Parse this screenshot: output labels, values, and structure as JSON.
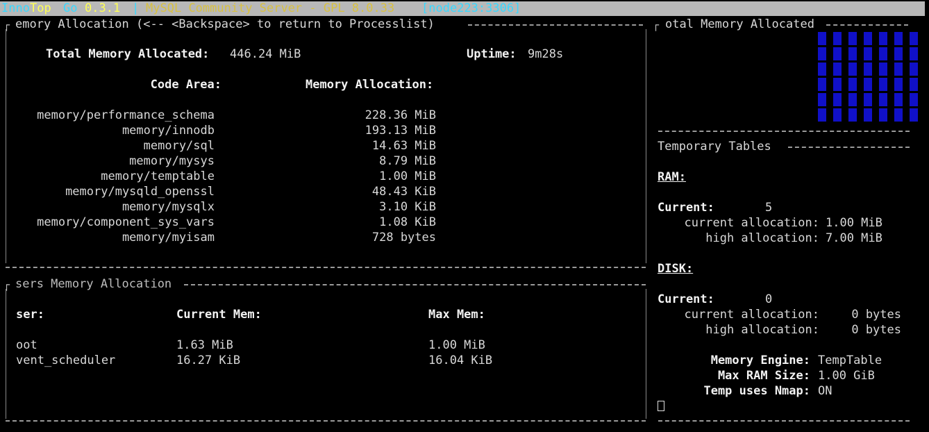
{
  "header": {
    "app_part1": "Inno",
    "app_part2": "Top",
    "app_part3": "Go",
    "version": "0.3.1",
    "separator": "|",
    "server": "MySQL Community Server - GPL 8.0.33",
    "node": "[node223:3306]"
  },
  "memory_panel": {
    "title": "emory Allocation (<-- <Backspace> to return to Processlist)",
    "total_label": "Total Memory Allocated:",
    "total_value": "446.24 MiB",
    "uptime_label": "Uptime:",
    "uptime_value": "9m28s",
    "col_code_area": "Code Area:",
    "col_allocation": "Memory Allocation:",
    "rows": [
      {
        "area": "memory/performance_schema",
        "value": "228.36 MiB"
      },
      {
        "area": "memory/innodb",
        "value": "193.13 MiB"
      },
      {
        "area": "memory/sql",
        "value": "14.63 MiB"
      },
      {
        "area": "memory/mysys",
        "value": "8.79 MiB"
      },
      {
        "area": "memory/temptable",
        "value": "1.00 MiB"
      },
      {
        "area": "memory/mysqld_openssl",
        "value": "48.43 KiB"
      },
      {
        "area": "memory/mysqlx",
        "value": "3.10 KiB"
      },
      {
        "area": "memory/component_sys_vars",
        "value": "1.08 KiB"
      },
      {
        "area": "memory/myisam",
        "value": "728 bytes"
      }
    ]
  },
  "users_panel": {
    "title": "sers Memory Allocation",
    "col_user": "ser:",
    "col_current": "Current Mem:",
    "col_max": "Max Mem:",
    "rows": [
      {
        "user": "oot",
        "current": "1.63 MiB",
        "max": "1.00 MiB"
      },
      {
        "user": "vent_scheduler",
        "current": "16.27 KiB",
        "max": "16.04 KiB"
      }
    ]
  },
  "gauge_panel": {
    "title": "otal Memory Allocated",
    "color": "#1010c8"
  },
  "temp_panel": {
    "title": "Temporary Tables",
    "ram_heading": "RAM:",
    "ram_current_label": "Current:",
    "ram_current_value": "5",
    "ram_cur_alloc_label": "current allocation:",
    "ram_cur_alloc_value": "1.00 MiB",
    "ram_high_alloc_label": "high allocation:",
    "ram_high_alloc_value": "7.00 MiB",
    "disk_heading": "DISK:",
    "disk_current_label": "Current:",
    "disk_current_value": "0",
    "disk_cur_alloc_label": "current allocation:",
    "disk_cur_alloc_value": "0 bytes",
    "disk_high_alloc_label": "high allocation:",
    "disk_high_alloc_value": "0 bytes",
    "engine_label": "Memory Engine:",
    "engine_value": "TempTable",
    "max_ram_label": "Max RAM Size:",
    "max_ram_value": "1.00 GiB",
    "nmap_label": "Temp uses Nmap:",
    "nmap_value": "ON"
  }
}
